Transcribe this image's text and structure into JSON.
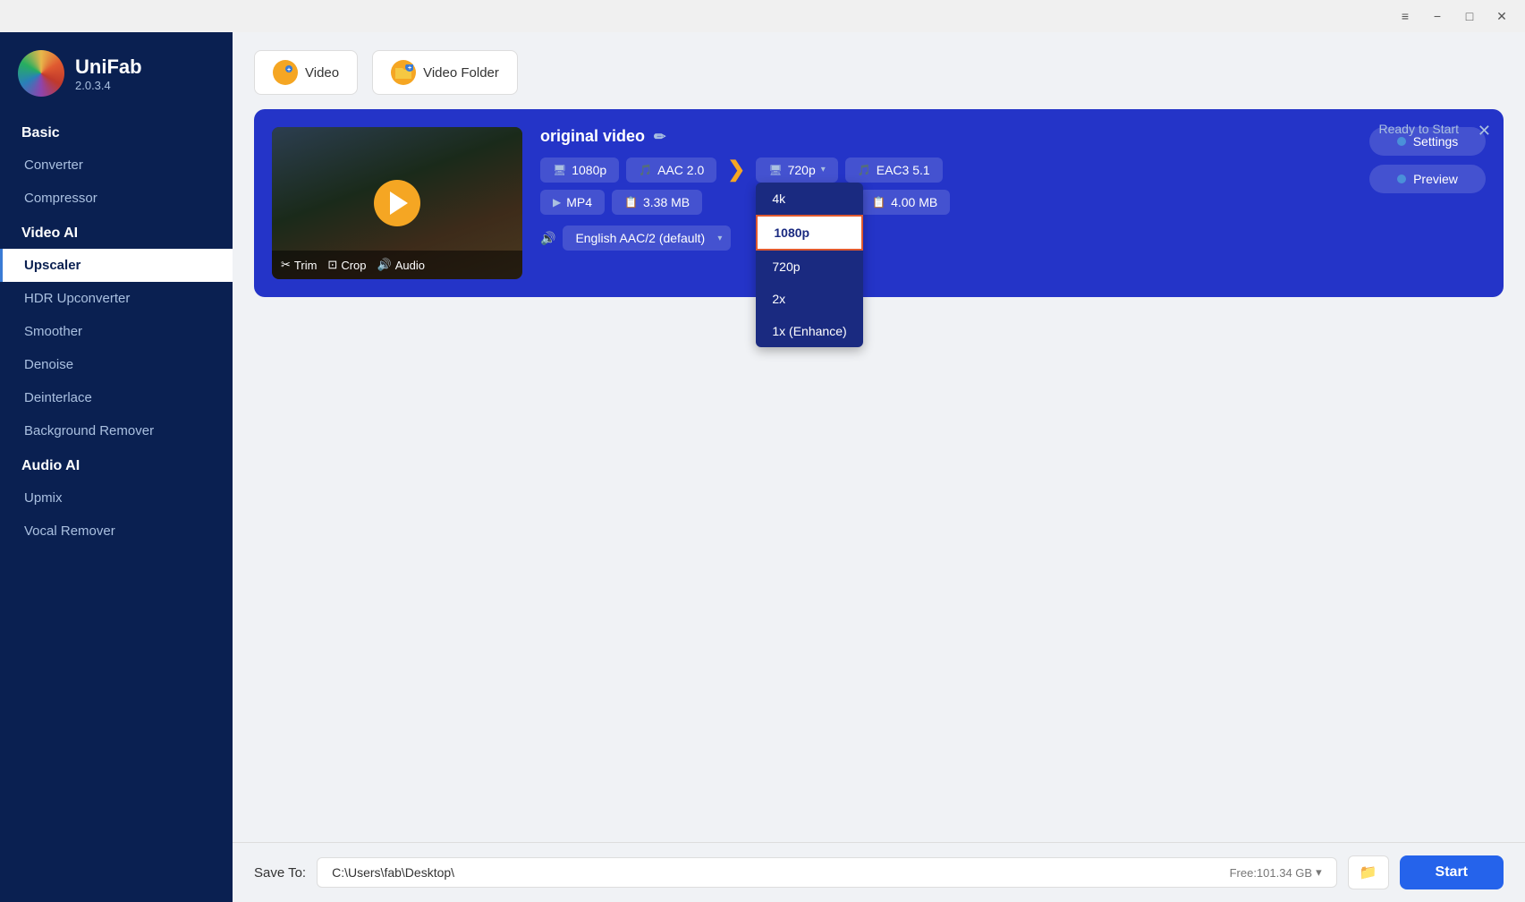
{
  "app": {
    "name": "UniFab",
    "version": "2.0.3.4"
  },
  "titlebar": {
    "menu_label": "≡",
    "minimize_label": "−",
    "maximize_label": "□",
    "close_label": "✕"
  },
  "sidebar": {
    "sections": [
      {
        "label": "Basic",
        "items": [
          {
            "id": "converter",
            "label": "Converter",
            "active": false
          },
          {
            "id": "compressor",
            "label": "Compressor",
            "active": false
          }
        ]
      },
      {
        "label": "Video AI",
        "items": [
          {
            "id": "upscaler",
            "label": "Upscaler",
            "active": true
          },
          {
            "id": "hdr-upconverter",
            "label": "HDR Upconverter",
            "active": false
          },
          {
            "id": "smoother",
            "label": "Smoother",
            "active": false
          },
          {
            "id": "denoise",
            "label": "Denoise",
            "active": false
          },
          {
            "id": "deinterlace",
            "label": "Deinterlace",
            "active": false
          },
          {
            "id": "background-remover",
            "label": "Background Remover",
            "active": false
          }
        ]
      },
      {
        "label": "Audio AI",
        "items": [
          {
            "id": "upmix",
            "label": "Upmix",
            "active": false
          },
          {
            "id": "vocal-remover",
            "label": "Vocal Remover",
            "active": false
          }
        ]
      }
    ]
  },
  "toolbar": {
    "add_video_label": "Video",
    "add_folder_label": "Video Folder"
  },
  "video_card": {
    "ready_text": "Ready to Start",
    "original_label": "original video",
    "input_resolution": "1080p",
    "input_codec": "AAC 2.0",
    "input_format": "MP4",
    "input_size": "3.38 MB",
    "output_resolution": "720p",
    "output_audio": "EAC3 5.1",
    "output_size": "4.00 MB",
    "audio_track": "English AAC/2 (default)",
    "settings_label": "Settings",
    "preview_label": "Preview",
    "trim_label": "Trim",
    "crop_label": "Crop",
    "audio_label": "Audio"
  },
  "resolution_dropdown": {
    "options": [
      {
        "id": "4k",
        "label": "4k",
        "selected": false
      },
      {
        "id": "1080p",
        "label": "1080p",
        "selected": true
      },
      {
        "id": "720p",
        "label": "720p",
        "selected": false
      },
      {
        "id": "2x",
        "label": "2x",
        "selected": false
      },
      {
        "id": "1x",
        "label": "1x (Enhance)",
        "selected": false
      }
    ]
  },
  "bottom_bar": {
    "save_label": "Save To:",
    "save_path": "C:\\Users\\fab\\Desktop\\",
    "free_space": "Free:101.34 GB",
    "start_label": "Start"
  }
}
